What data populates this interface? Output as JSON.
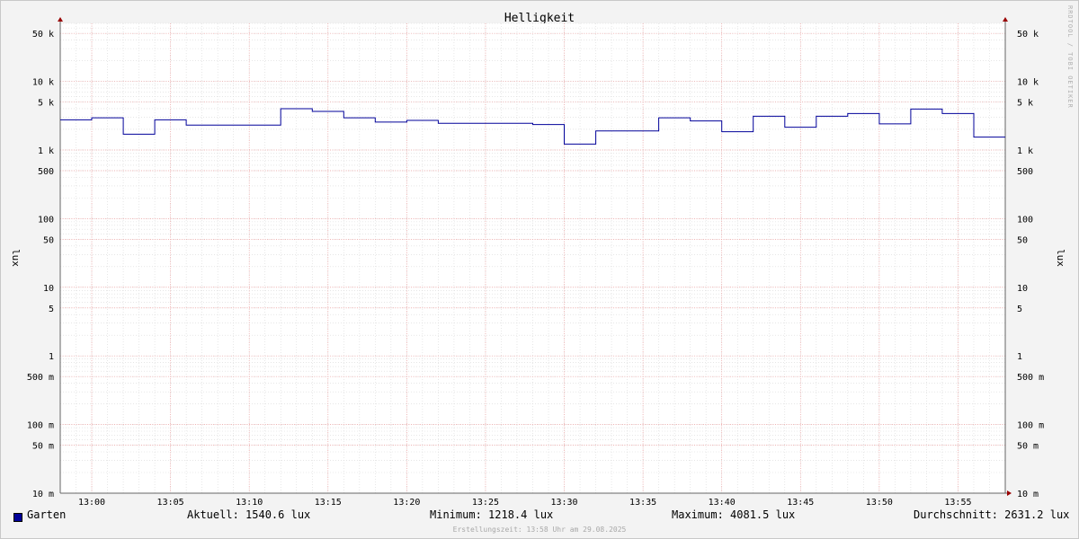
{
  "colors": {
    "background": "#f3f3f3",
    "plot_background": "#ffffff",
    "series": "#000099",
    "major_grid": "#f0a0a0",
    "minor_grid": "#d8d8d8",
    "arrow": "#990000"
  },
  "chart_data": {
    "type": "line",
    "title": "Helligkeit",
    "ylabel": "lux",
    "right_ylabel": "lux",
    "y_scale": "log",
    "ylim": [
      0.01,
      70000
    ],
    "xlim": [
      "12:58",
      "13:58"
    ],
    "grid": true,
    "x_ticks": [
      "13:00",
      "13:05",
      "13:10",
      "13:15",
      "13:20",
      "13:25",
      "13:30",
      "13:35",
      "13:40",
      "13:45",
      "13:50",
      "13:55"
    ],
    "y_ticks": [
      {
        "value": 50000,
        "label": "50 k"
      },
      {
        "value": 10000,
        "label": "10 k"
      },
      {
        "value": 5000,
        "label": "5 k"
      },
      {
        "value": 1000,
        "label": "1 k"
      },
      {
        "value": 500,
        "label": "500"
      },
      {
        "value": 100,
        "label": "100"
      },
      {
        "value": 50,
        "label": "50"
      },
      {
        "value": 10,
        "label": "10"
      },
      {
        "value": 5,
        "label": "5"
      },
      {
        "value": 1,
        "label": "1"
      },
      {
        "value": 0.5,
        "label": "500 m"
      },
      {
        "value": 0.1,
        "label": "100 m"
      },
      {
        "value": 0.05,
        "label": "50 m"
      },
      {
        "value": 0.01,
        "label": "10 m"
      }
    ],
    "series": [
      {
        "name": "Garten",
        "step": true,
        "x": [
          "12:58",
          "13:00",
          "13:02",
          "13:04",
          "13:06",
          "13:08",
          "13:10",
          "13:12",
          "13:14",
          "13:16",
          "13:18",
          "13:20",
          "13:22",
          "13:24",
          "13:26",
          "13:28",
          "13:30",
          "13:32",
          "13:34",
          "13:36",
          "13:38",
          "13:40",
          "13:42",
          "13:44",
          "13:46",
          "13:48",
          "13:50",
          "13:52",
          "13:54",
          "13:56"
        ],
        "values": [
          2750,
          2950,
          1700,
          2750,
          2300,
          2300,
          2300,
          4000,
          3650,
          2950,
          2550,
          2700,
          2450,
          2450,
          2450,
          2350,
          1220,
          1900,
          1900,
          2950,
          2650,
          1850,
          3100,
          2150,
          3100,
          3400,
          2400,
          3950,
          3400,
          1540
        ]
      }
    ]
  },
  "legend": {
    "series_name": "Garten",
    "aktuell": "Aktuell: 1540.6 lux",
    "minimum": "Minimum: 1218.4 lux",
    "maximum": "Maximum: 4081.5 lux",
    "durchschnitt": "Durchschnitt: 2631.2 lux"
  },
  "footer": "Erstellungszeit: 13:58 Uhr am 29.08.2025",
  "watermark": "RRDTOOL / TOBI OETIKER"
}
